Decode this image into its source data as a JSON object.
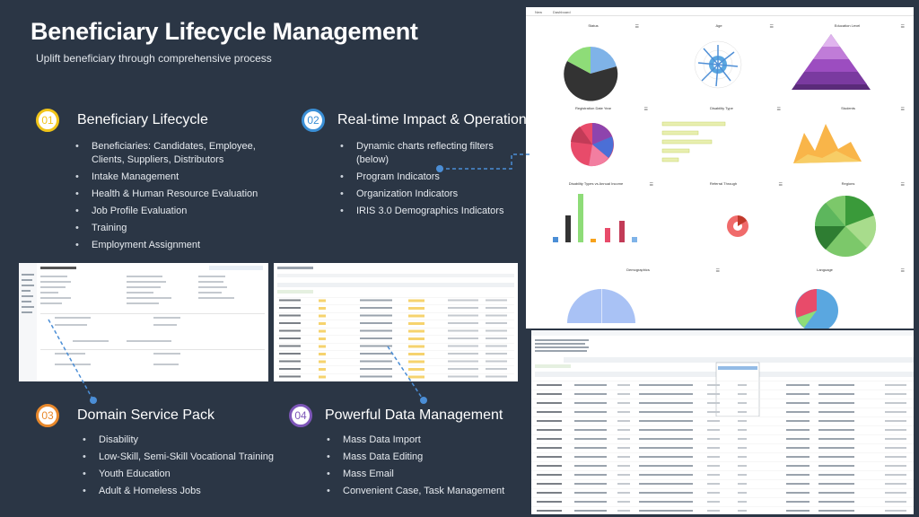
{
  "header": {
    "title": "Beneficiary Lifecycle Management",
    "subtitle": "Uplift beneficiary through comprehensive process"
  },
  "sections": [
    {
      "number": "01",
      "title": "Beneficiary Lifecycle",
      "items": [
        "Beneficiaries: Candidates, Employee, Clients, Suppliers, Distributors",
        "Intake Management",
        "Health & Human Resource Evaluation",
        "Job Profile Evaluation",
        "Training",
        "Employment Assignment"
      ]
    },
    {
      "number": "02",
      "title": "Real-time Impact & Operation",
      "items": [
        "Dynamic charts reflecting filters (below)",
        "Program Indicators",
        "Organization Indicators",
        "IRIS 3.0 Demographics Indicators"
      ]
    },
    {
      "number": "03",
      "title": "Domain Service Pack",
      "items": [
        "Disability",
        "Low-Skill, Semi-Skill Vocational Training",
        "Youth Education",
        "Adult & Homeless Jobs"
      ]
    },
    {
      "number": "04",
      "title": "Powerful Data Management",
      "items": [
        "Mass Data Import",
        "Mass Data Editing",
        "Mass Email",
        "Convenient Case, Task Management"
      ]
    }
  ],
  "dashboard": {
    "tabs": [
      "New",
      "Dashboard"
    ],
    "charts": [
      {
        "title": "Status"
      },
      {
        "title": "Age"
      },
      {
        "title": "Education Level"
      },
      {
        "title": "Registration Date Year"
      },
      {
        "title": "Disability Type"
      },
      {
        "title": "Students"
      },
      {
        "title": "Disability Types vs Annual Income"
      },
      {
        "title": "Referral Through"
      },
      {
        "title": "Regions"
      },
      {
        "title": "Demographics"
      },
      {
        "title": "Language"
      }
    ]
  },
  "colors": {
    "background": "#2b3645",
    "num1": "#f0c419",
    "num2": "#3a8fd6",
    "num3": "#e8882b",
    "num4": "#7d56b8",
    "connector": "#4b8ed6"
  }
}
